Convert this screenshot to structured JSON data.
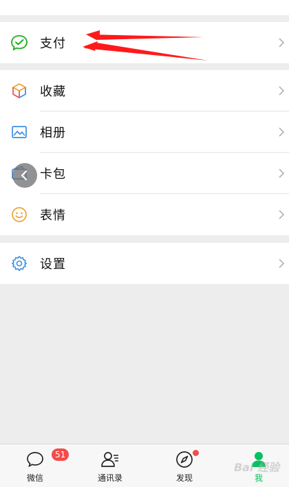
{
  "menu": {
    "pay": {
      "label": "支付",
      "icon": "wechat-pay-icon"
    },
    "favorites": {
      "label": "收藏",
      "icon": "cube-icon"
    },
    "album": {
      "label": "相册",
      "icon": "image-icon"
    },
    "cards": {
      "label": "卡包",
      "icon": "wallet-icon"
    },
    "stickers": {
      "label": "表情",
      "icon": "smiley-icon"
    },
    "settings": {
      "label": "设置",
      "icon": "gear-icon"
    }
  },
  "tabbar": {
    "tabs": [
      {
        "label": "微信",
        "icon": "chat-icon",
        "badge": "51"
      },
      {
        "label": "通讯录",
        "icon": "contacts-icon"
      },
      {
        "label": "发现",
        "icon": "compass-icon"
      },
      {
        "label": "我",
        "icon": "person-icon",
        "active": true
      }
    ]
  },
  "colors": {
    "accent": "#07c160",
    "badge": "#f44b4b",
    "annotation_arrow": "#ff1a1a"
  },
  "watermark": {
    "text": "Bai 经验"
  }
}
